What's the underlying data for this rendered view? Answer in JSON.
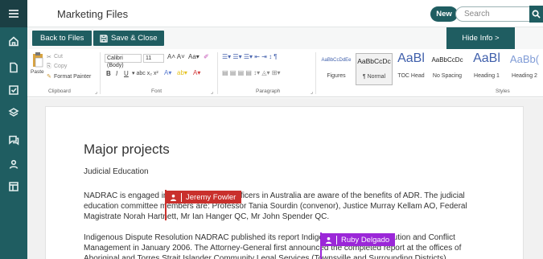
{
  "app": {
    "document_title": "Marketing Files"
  },
  "topbar": {
    "new_label": "New",
    "search_placeholder": "Search"
  },
  "actions": {
    "back_label": "Back to Files",
    "save_label": "Save & Close",
    "hide_info_label": "Hide Info >"
  },
  "ribbon": {
    "clipboard": {
      "paste": "Paste",
      "cut": "Cut",
      "copy": "Copy",
      "format_painter": "Format Painter",
      "label": "Clipboard"
    },
    "font": {
      "family": "Calibri (Body)",
      "size": "11",
      "label": "Font"
    },
    "paragraph": {
      "label": "Paragraph"
    },
    "styles": {
      "label": "Styles",
      "items": [
        {
          "sample": "AaBbCcDdEe",
          "name": "Figures"
        },
        {
          "sample": "AaBbCcDc",
          "name": "¶ Normal"
        },
        {
          "sample": "AaBl",
          "name": "TOC Head"
        },
        {
          "sample": "AaBbCcDc",
          "name": "No Spacing"
        },
        {
          "sample": "AaBl",
          "name": "Heading 1"
        },
        {
          "sample": "AaBb(",
          "name": "Heading 2"
        }
      ]
    }
  },
  "document": {
    "heading": "Major projects",
    "subheading": "Judicial Education",
    "paragraph1": "NADRAC is engaged in educating judicial officers in Australia are aware of the benefits of ADR. The judicial education committee members are: Professor Tania Sourdin (convenor), Justice Murray Kellam AO, Federal Magistrate Norah Hartnett, Mr Ian Hanger QC, Mr John Spender QC.",
    "paragraph2": "Indigenous Dispute Resolution NADRAC published its report Indigenous Dispute Resolution and Conflict Management in January 2006. The Attorney-General first announced the completed report at the offices of Aboriginal and Torres Strait Islander Community Legal Services (Townsville and Surrounding Districts)."
  },
  "collaborators": [
    {
      "name": "Jeremy Fowler",
      "color": "#c9302c"
    },
    {
      "name": "Ruby Delgado",
      "color": "#9b27d8"
    }
  ],
  "colors": {
    "brand": "#1f5d61",
    "nav_dark": "#1b3f44"
  }
}
